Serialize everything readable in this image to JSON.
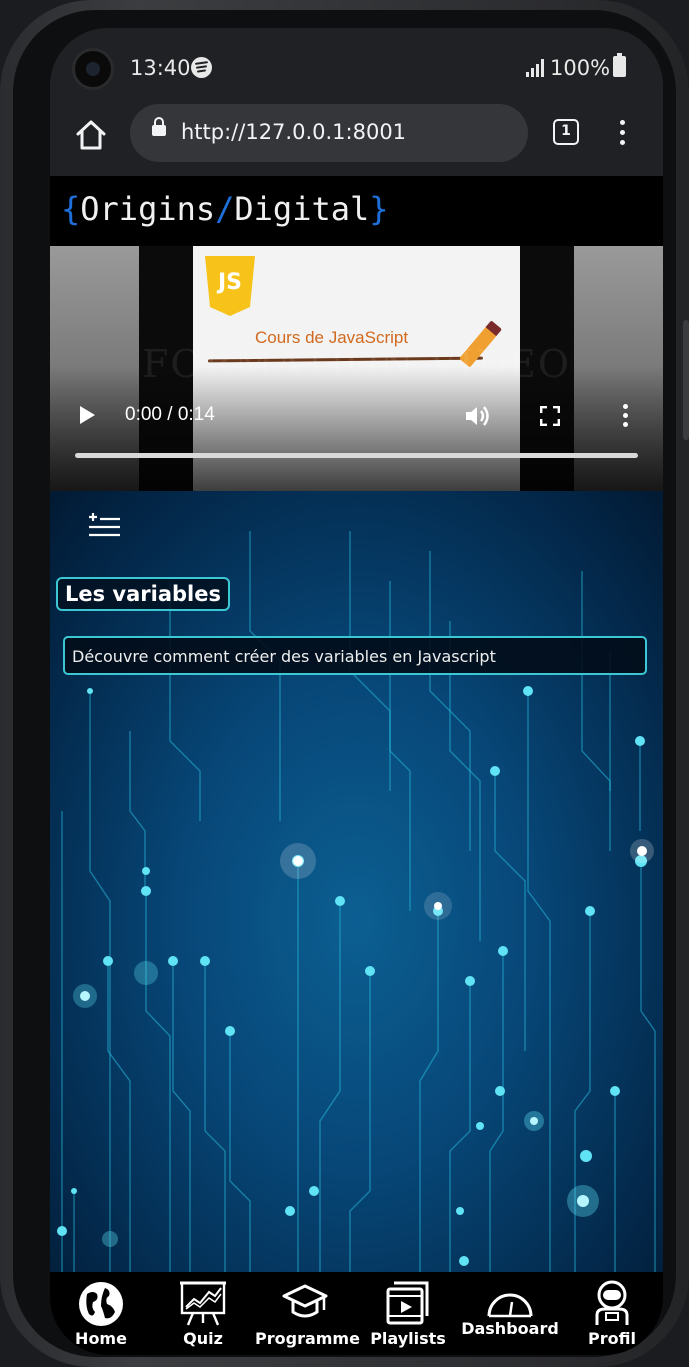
{
  "status_bar": {
    "time": "13:40",
    "battery": "100%"
  },
  "browser": {
    "url": "http://127.0.0.1:8001",
    "tab_count": "1"
  },
  "site": {
    "logo_left_brace": "{",
    "logo_word1": "Origins",
    "logo_slash": "/",
    "logo_word2": "Digital",
    "logo_right_brace": "}",
    "brand_color": "#1e6fd9"
  },
  "video": {
    "thumbnail_title": "Cours de JavaScript",
    "thumbnail_badge": "JS",
    "thumbnail_watermark": "FORMATION VIDEO",
    "time_display": "0:00 / 0:14",
    "progress": 0
  },
  "content": {
    "title": "Les variables",
    "description": "Découvre comment créer des variables en Javascript",
    "accent_color": "#3cc7d4"
  },
  "nav": {
    "home": "Home",
    "quiz": "Quiz",
    "programme": "Programme",
    "playlists": "Playlists",
    "dashboard": "Dashboard",
    "profil": "Profil"
  }
}
